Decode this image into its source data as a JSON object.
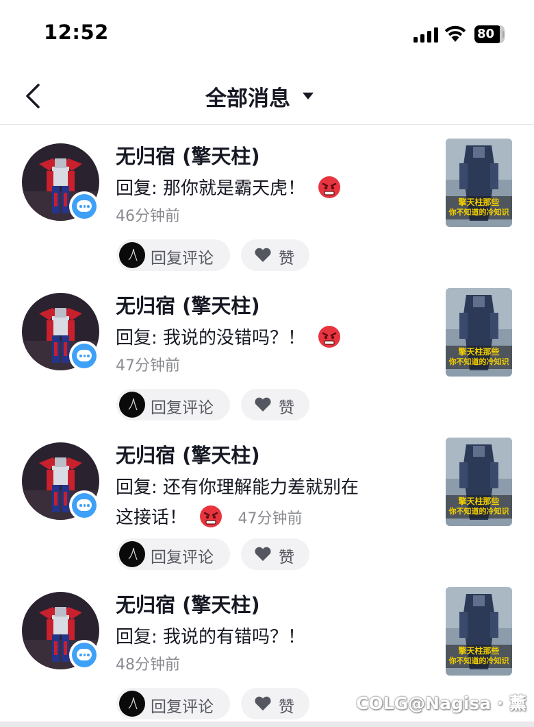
{
  "status_bar": {
    "time": "12:52",
    "battery": "80"
  },
  "header": {
    "title": "全部消息"
  },
  "messages": [
    {
      "username": "无归宿 (擎天柱)",
      "reply_label": "回复:",
      "reply": "那你就是霸天虎！",
      "time": "46分钟前",
      "reply_button": "回复评论",
      "like_button": "赞",
      "thumb_caption_1": "擎天柱那些",
      "thumb_caption_2": "你不知道的冷知识"
    },
    {
      "username": "无归宿 (擎天柱)",
      "reply_label": "回复:",
      "reply": "我说的没错吗？！",
      "time": "47分钟前",
      "reply_button": "回复评论",
      "like_button": "赞",
      "thumb_caption_1": "擎天柱那些",
      "thumb_caption_2": "你不知道的冷知识"
    },
    {
      "username": "无归宿 (擎天柱)",
      "reply_label": "回复:",
      "reply": "还有你理解能力差就别在",
      "reply_line2": "这接话！",
      "time": "47分钟前",
      "reply_button": "回复评论",
      "like_button": "赞",
      "thumb_caption_1": "擎天柱那些",
      "thumb_caption_2": "你不知道的冷知识"
    },
    {
      "username": "无归宿 (擎天柱)",
      "reply_label": "回复:",
      "reply": "我说的有错吗？！",
      "time": "48分钟前",
      "reply_button": "回复评论",
      "like_button": "赞",
      "thumb_caption_1": "擎天柱那些",
      "thumb_caption_2": "你不知道的冷知识"
    }
  ],
  "watermark": "COLG@Nagisa · 薰",
  "icons": {
    "back": "chevron-left-icon",
    "dropdown": "caret-down-icon",
    "badge": "chat-bubble-icon",
    "emoji": "angry-face-icon",
    "like": "heart-icon"
  },
  "colors": {
    "accent": "#3ea0f6",
    "text_primary": "#161823",
    "text_secondary": "#8a8b91",
    "pill_bg": "#f2f2f4"
  }
}
